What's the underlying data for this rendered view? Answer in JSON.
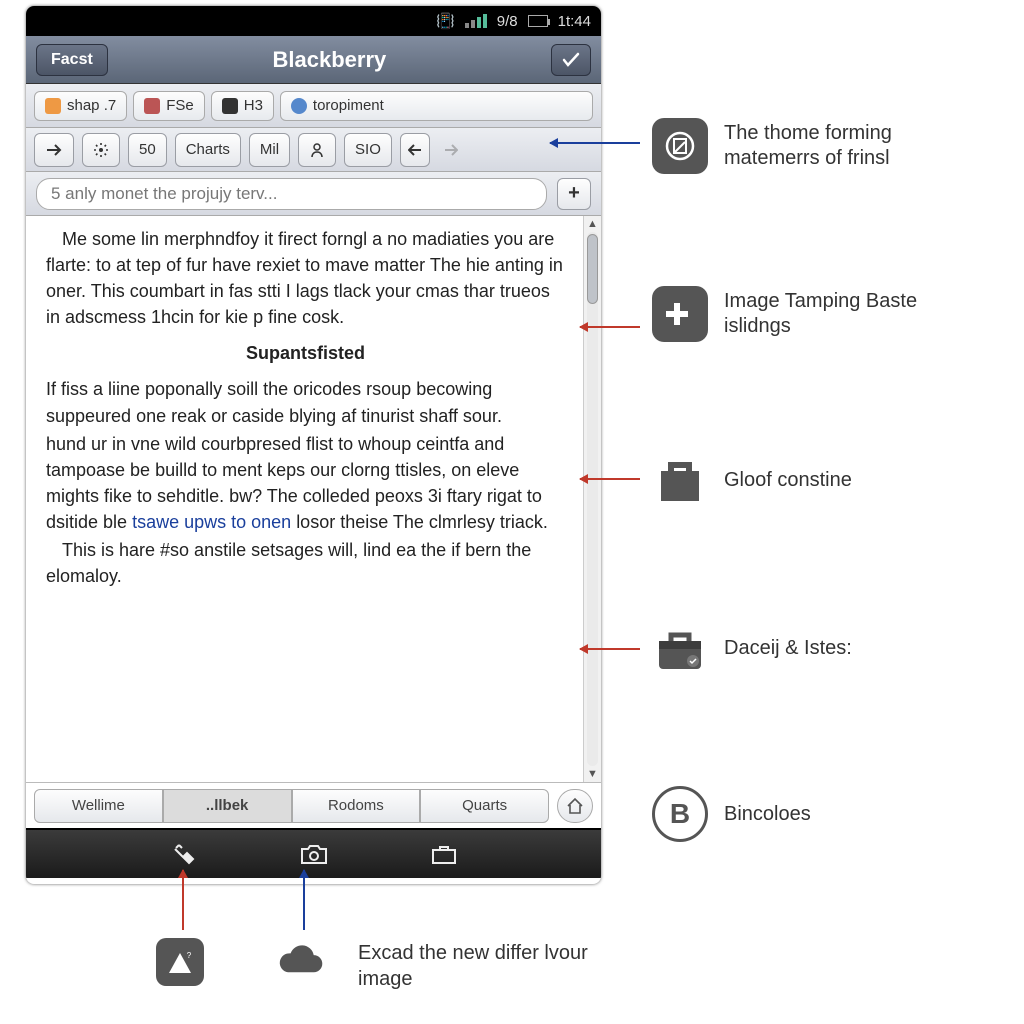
{
  "statusbar": {
    "battery": "9/8",
    "time": "1t:44"
  },
  "titlebar": {
    "back": "Facst",
    "title": "Blackberry"
  },
  "tabrow": [
    {
      "label": "shap .7"
    },
    {
      "label": "FSe"
    },
    {
      "label": "H3"
    },
    {
      "label": "toropiment"
    }
  ],
  "toolrow": {
    "count": "50",
    "charts": "Charts",
    "mil": "Mil",
    "sio": "SIO"
  },
  "search": {
    "value": "5 anly monet the projujy terv..."
  },
  "article": {
    "p1": "Me some lin merphndfoy it firect forngl a no madiaties you are flarte: to at tep of fur have rexiet to mave matter The hie anting in oner. This coumbart in fas stti I lags tlack your cmas thar trueos in adscmess 1hcin for kie p fine cosk.",
    "subhead": "Supantsfisted",
    "p2a": "If fiss a liine poponally soill the oricodes rsoup becowing suppeured one reak or caside blying af tinurist shaff sour.",
    "p2b": "hund ur in vne wild courbpresed flist to whoup ceintfa and tampoase be builld to ment keps our clorng ttisles, on eleve mights fike to sehditle. bw? The colleded peoxs 3i ftary rigat to dsitide ble ",
    "link": "tsawe upws to onen",
    "p2c": " losor theise The clmrlesy triack.",
    "p3": "This is hare #so anstile setsages will, lind ea the if bern the elomaloy."
  },
  "bottom_tabs": [
    "Wellime",
    "..llbek",
    "Rodoms",
    "Quarts"
  ],
  "callouts": [
    {
      "text": "The thome forming matemerrs of frinsl"
    },
    {
      "text": "Image Tamping Baste islidngs"
    },
    {
      "text": "Gloof constine"
    },
    {
      "text": "Daceij & Istes:"
    },
    {
      "text": "Bincoloes"
    }
  ],
  "bottom_text": "Excad the new differ lvour image"
}
